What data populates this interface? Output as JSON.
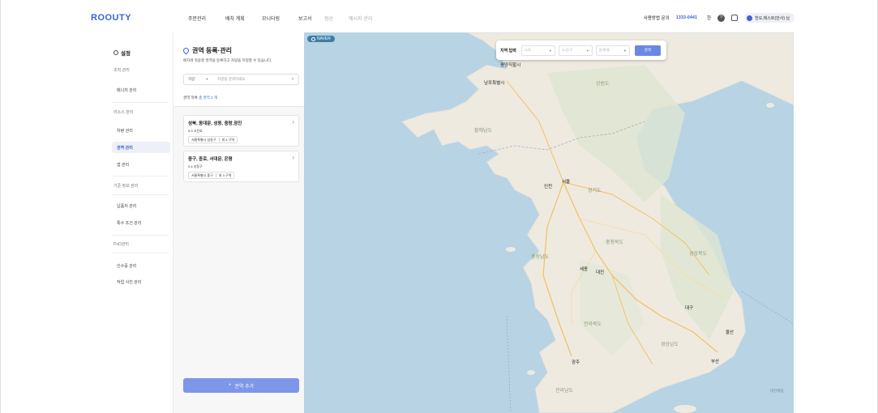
{
  "header": {
    "logo": "ROOUTY",
    "nav": [
      "주문관리",
      "배차 계획",
      "모니터링",
      "보고서",
      "정산",
      "메시지 관리"
    ],
    "inquiry_label": "사용방법 문의",
    "phone": "1333-0441",
    "lang": "한",
    "user_name": "찬오,테스트(안사) 님"
  },
  "sidebar": {
    "title": "설정",
    "groups": [
      {
        "label": "조직 관리",
        "items": [
          "매니저 관리"
        ]
      },
      {
        "label": "리소스 관리",
        "items": [
          "차량 관리",
          "권역 관리",
          "앱 관리"
        ]
      },
      {
        "label": "기준 정보 관리",
        "items": [
          "납품처 관리",
          "특수 조건 관리"
        ]
      },
      {
        "label": "PoD관리",
        "items": [
          "인수증 관리",
          "작업 사진 관리"
        ]
      }
    ],
    "active_item": "권역 관리"
  },
  "panel": {
    "title": "권역 등록·관리",
    "description": "배차에 적용할 권역을 등록하고 차량을 지정할 수 있습니다.",
    "search": {
      "category": "차량",
      "placeholder": "차량을 검색하세요"
    },
    "count_label": "권역 목록",
    "count_value": "총 권역 2 개",
    "regions": [
      {
        "name": "성북, 동대문, 성동, 중랑,광진",
        "sub": "9.9 고진호",
        "city": "서울특별시 성동구",
        "count": "외 4 구역"
      },
      {
        "name": "중구, 종로, 서대문, 은평",
        "sub": "0.4 성동구",
        "city": "서울특별시 중구",
        "count": "외 3 구역"
      }
    ],
    "add_button": "권역 추가"
  },
  "map": {
    "provider": "NAVER",
    "filter": {
      "label": "지역 입력",
      "select1": "시/도",
      "select2": "시/군/구",
      "select3": "읍/면/동",
      "button": "검색"
    },
    "labels": [
      {
        "t": "평양직할시",
        "c": "city"
      },
      {
        "t": "남포특별시",
        "c": "city"
      },
      {
        "t": "강원도",
        "c": "prov"
      },
      {
        "t": "황해남도",
        "c": "prov"
      },
      {
        "t": "서울",
        "c": "city"
      },
      {
        "t": "인천",
        "c": "city"
      },
      {
        "t": "경기도",
        "c": "prov"
      },
      {
        "t": "충청북도",
        "c": "prov"
      },
      {
        "t": "충청남도",
        "c": "prov"
      },
      {
        "t": "경상북도",
        "c": "prov"
      },
      {
        "t": "대전",
        "c": "city"
      },
      {
        "t": "세종",
        "c": "city"
      },
      {
        "t": "대구",
        "c": "city"
      },
      {
        "t": "울산",
        "c": "city"
      },
      {
        "t": "부산",
        "c": "city"
      },
      {
        "t": "광주",
        "c": "city"
      },
      {
        "t": "전라북도",
        "c": "prov"
      },
      {
        "t": "경상남도",
        "c": "prov"
      },
      {
        "t": "전라남도",
        "c": "prov"
      },
      {
        "t": "대한해협",
        "c": "sea"
      }
    ]
  },
  "colors": {
    "brand": "#3b63d6",
    "button": "#7d96e8",
    "sea": "#b7d3e4",
    "land": "#eeeae0"
  }
}
